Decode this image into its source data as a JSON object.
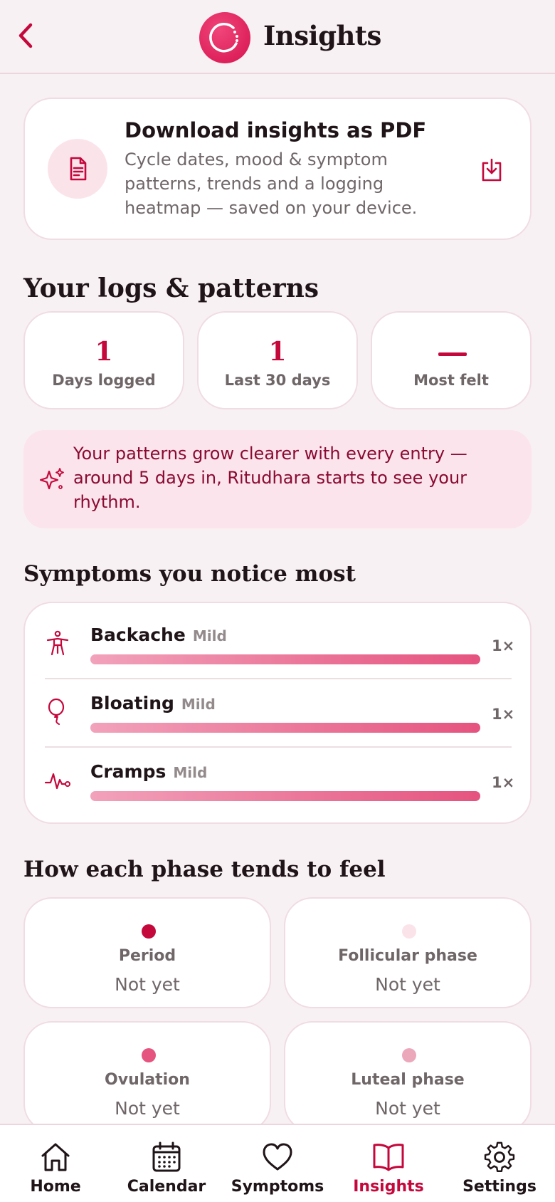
{
  "header": {
    "title": "Insights",
    "back_icon": "chevron-left-icon",
    "logo_icon": "app-logo-icon"
  },
  "pdf_card": {
    "title": "Download insights as PDF",
    "description": "Cycle dates, mood & symptom patterns, trends and a logging heatmap — saved on your device.",
    "file_icon": "document-icon",
    "action_icon": "download-icon"
  },
  "logs": {
    "title": "Your logs & patterns",
    "stats": [
      {
        "value": "1",
        "label": "Days logged"
      },
      {
        "value": "1",
        "label": "Last 30 days"
      },
      {
        "value": "—",
        "label": "Most felt"
      }
    ]
  },
  "tip": {
    "icon": "sparkles-icon",
    "text": "Your patterns grow clearer with every entry — around 5 days in, Ritudhara starts to see your rhythm."
  },
  "symptoms": {
    "title": "Symptoms you notice most",
    "items": [
      {
        "name": "Backache",
        "severity": "Mild",
        "count": "1×",
        "icon": "body-icon",
        "level": 1.0
      },
      {
        "name": "Bloating",
        "severity": "Mild",
        "count": "1×",
        "icon": "balloon-icon",
        "level": 1.0
      },
      {
        "name": "Cramps",
        "severity": "Mild",
        "count": "1×",
        "icon": "pulse-icon",
        "level": 1.0
      }
    ]
  },
  "phases": {
    "title": "How each phase tends to feel",
    "items": [
      {
        "name": "Period",
        "value": "Not yet",
        "color": "#c4083c"
      },
      {
        "name": "Follicular phase",
        "value": "Not yet",
        "color": "#fbe3ea"
      },
      {
        "name": "Ovulation",
        "value": "Not yet",
        "color": "#e5537f"
      },
      {
        "name": "Luteal phase",
        "value": "Not yet",
        "color": "#eba8bb"
      }
    ]
  },
  "nav": {
    "items": [
      {
        "label": "Home",
        "icon": "home-icon"
      },
      {
        "label": "Calendar",
        "icon": "calendar-icon"
      },
      {
        "label": "Symptoms",
        "icon": "heart-icon"
      },
      {
        "label": "Insights",
        "icon": "book-icon",
        "active": true
      },
      {
        "label": "Settings",
        "icon": "gear-icon"
      }
    ]
  },
  "colors": {
    "accent": "#c4083c",
    "background": "#f8f1f3",
    "tip_background": "#fbe4eb"
  }
}
